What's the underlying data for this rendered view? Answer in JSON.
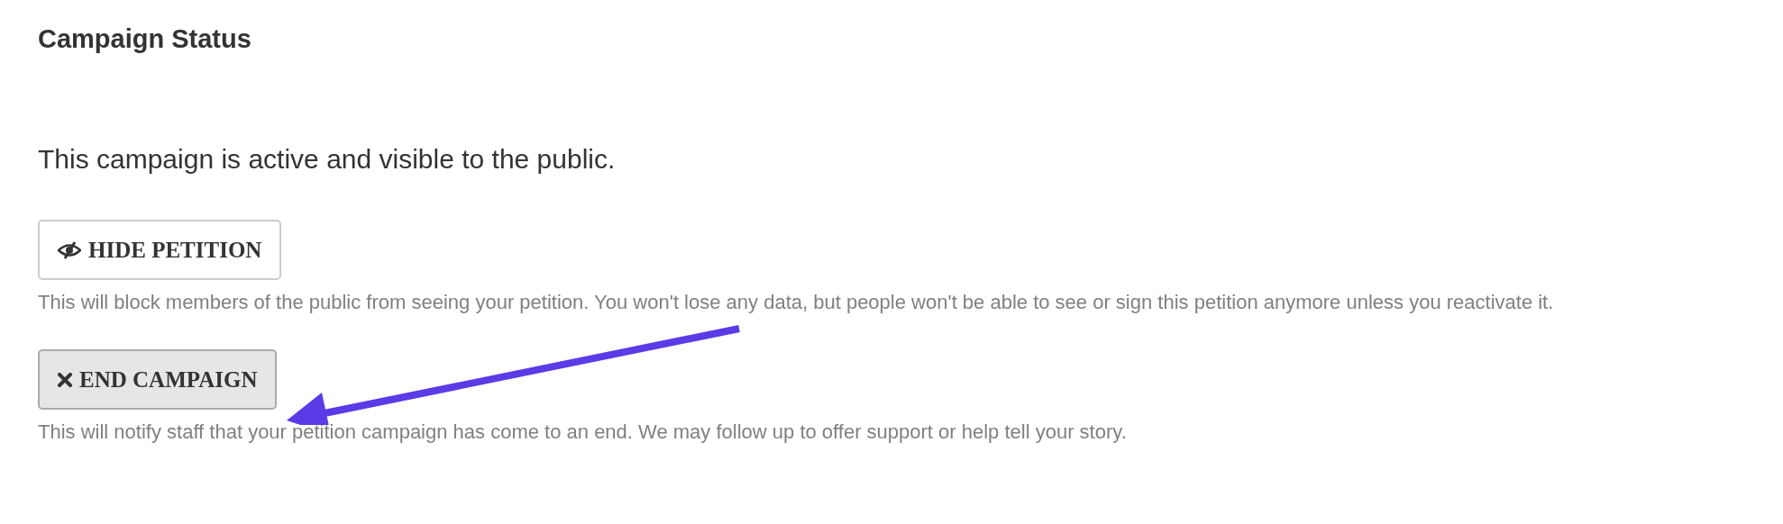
{
  "title": "Campaign Status",
  "status_message": "This campaign is active and visible to the public.",
  "actions": [
    {
      "kind": "hide",
      "label": "HIDE PETITION",
      "description": "This will block members of the public from seeing your petition. You won't lose any data, but people won't be able to see or sign this petition anymore unless you reactivate it."
    },
    {
      "kind": "end",
      "label": "END CAMPAIGN",
      "description": "This will notify staff that your petition campaign has come to an end. We may follow up to offer support or help tell your story."
    }
  ]
}
